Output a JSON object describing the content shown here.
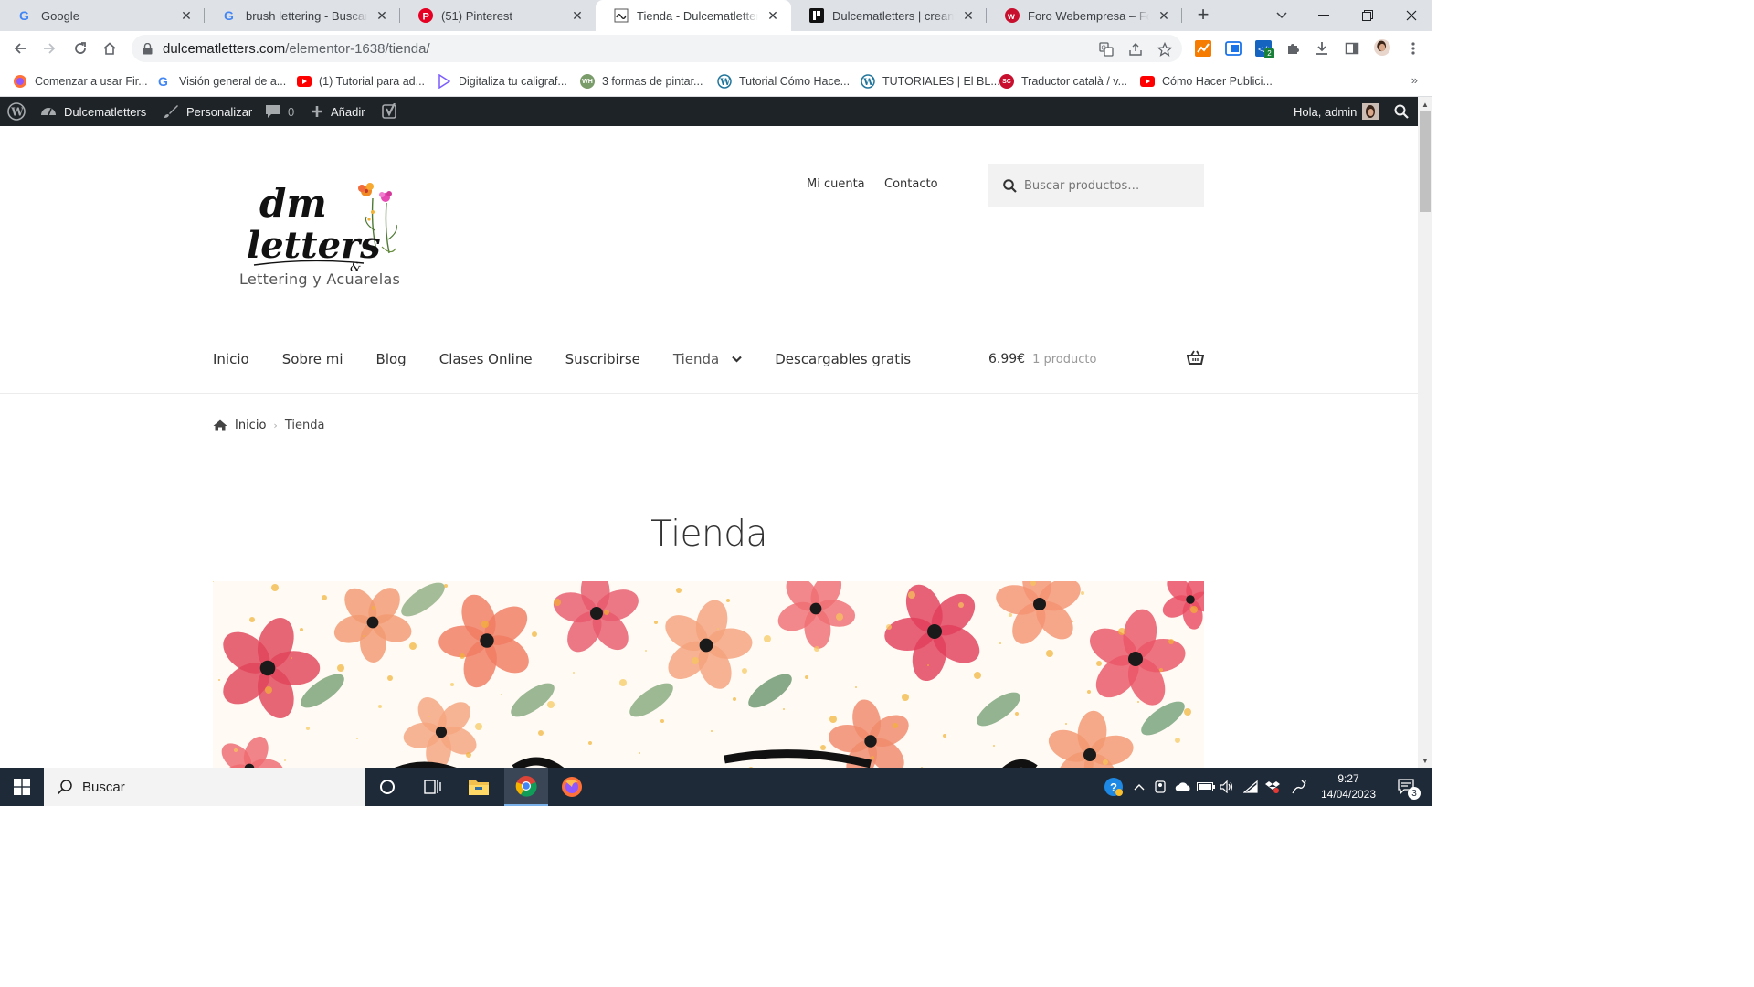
{
  "tabs": [
    {
      "title": "Google",
      "icon": "google-icon",
      "active": false
    },
    {
      "title": "brush lettering - Buscar con Google",
      "icon": "google-icon",
      "active": false
    },
    {
      "title": "(51) Pinterest",
      "icon": "pinterest-icon",
      "active": false
    },
    {
      "title": "Tienda - Dulcematletters",
      "icon": "dulcemat-favicon",
      "active": true
    },
    {
      "title": "Dulcematletters | creando Ma",
      "icon": "dulcemat-dark-favicon",
      "active": false
    },
    {
      "title": "Foro Webempresa – Foro We",
      "icon": "webempresa-icon",
      "active": false
    }
  ],
  "browser": {
    "new_tab": "+",
    "url_host": "dulcematletters.com",
    "url_path": "/elementor-1638/tienda/",
    "extension_badge": "2"
  },
  "bookmarks": [
    {
      "label": "Comenzar a usar Fir...",
      "icon": "firefox-icon"
    },
    {
      "label": "Visión general de a...",
      "icon": "google-icon"
    },
    {
      "label": "(1) Tutorial para ad...",
      "icon": "youtube-icon"
    },
    {
      "label": "Digitaliza tu caligraf...",
      "icon": "play-icon"
    },
    {
      "label": "3 formas de pintar...",
      "icon": "wh-icon"
    },
    {
      "label": "Tutorial Cómo Hace...",
      "icon": "wordpress-icon"
    },
    {
      "label": "TUTORIALES | El BL...",
      "icon": "wordpress-icon"
    },
    {
      "label": "Traductor català / v...",
      "icon": "sc-icon"
    },
    {
      "label": "Cómo Hacer Publici...",
      "icon": "youtube-icon"
    }
  ],
  "bookmarks_more": "»",
  "adminbar": {
    "site_name": "Dulcematletters",
    "customize": "Personalizar",
    "comments_count": "0",
    "add_new": "Añadir",
    "greeting": "Hola, admin"
  },
  "site": {
    "logo_text": "Lettering y Acuarelas",
    "top_links": [
      "Mi cuenta",
      "Contacto"
    ],
    "search_placeholder": "Buscar productos…",
    "nav": [
      "Inicio",
      "Sobre mi",
      "Blog",
      "Clases Online",
      "Suscribirse",
      "Tienda",
      "Descargables gratis"
    ],
    "cart_amount": "6.99€",
    "cart_count": "1 producto",
    "breadcrumb_home": "Inicio",
    "breadcrumb_current": "Tienda",
    "page_title": "Tienda",
    "accent_color": "#f28b6b"
  },
  "taskbar": {
    "search_label": "Buscar",
    "time": "9:27",
    "date": "14/04/2023",
    "notifications": "3"
  }
}
